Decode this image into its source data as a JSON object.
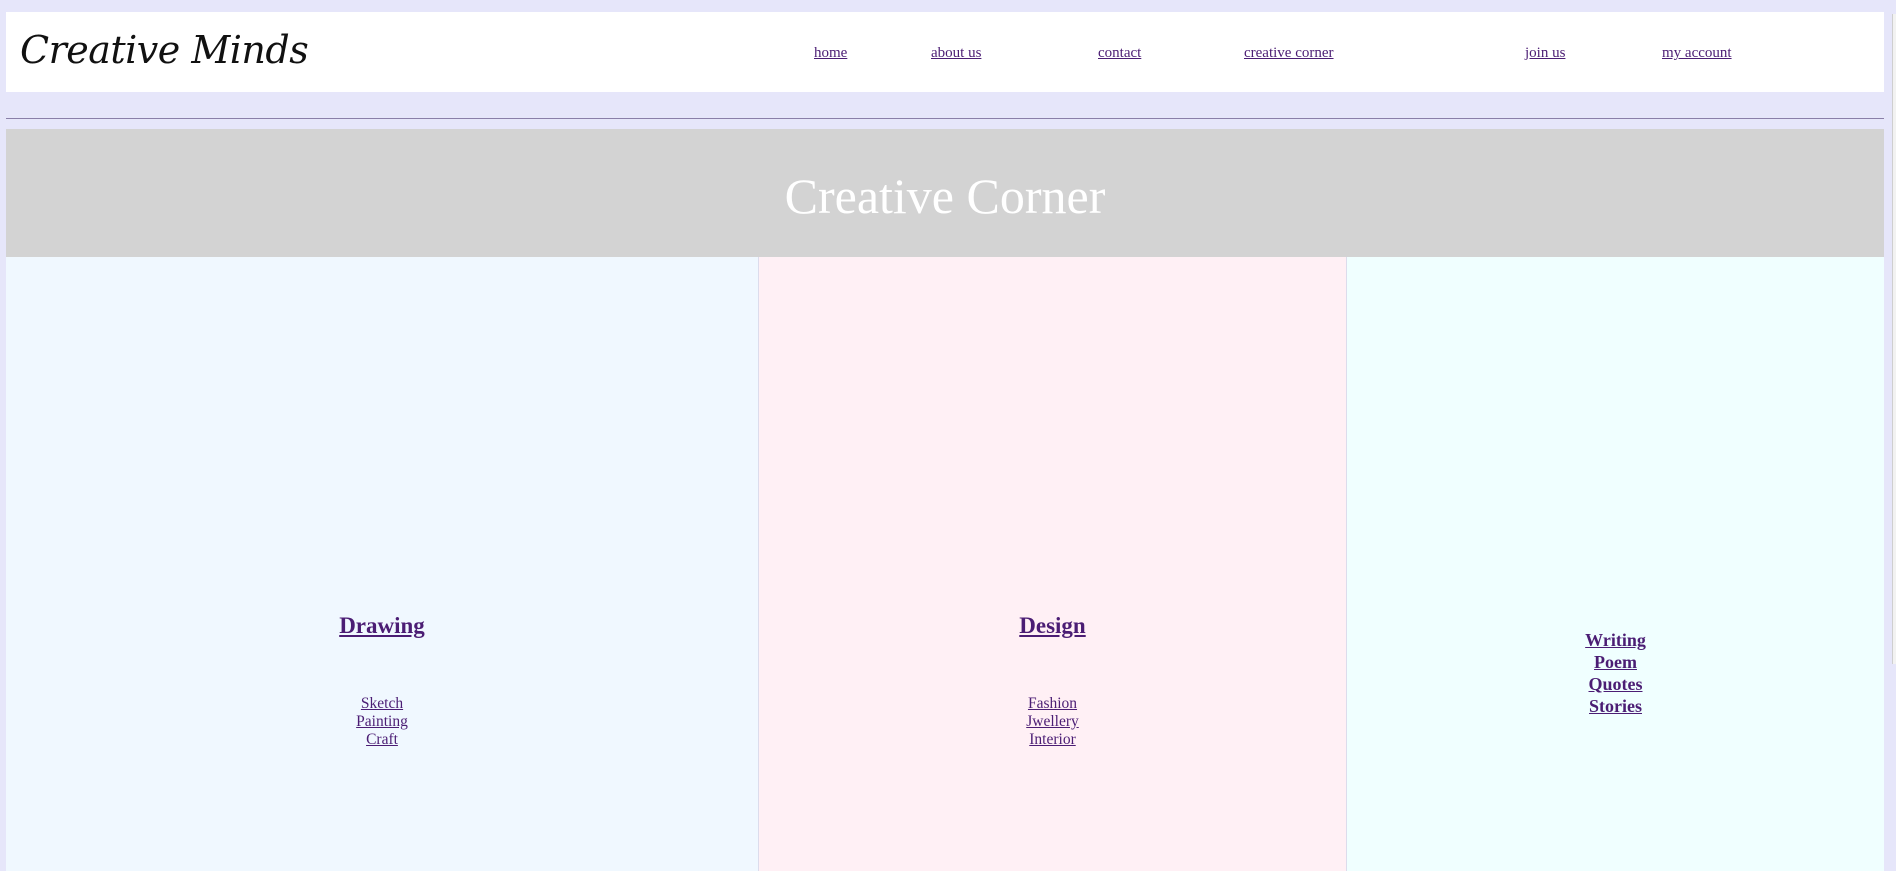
{
  "header": {
    "logo": "Creative Minds",
    "nav": [
      {
        "label": "home"
      },
      {
        "label": "about us"
      },
      {
        "label": "contact"
      },
      {
        "label": "creative corner"
      },
      {
        "label": "join us"
      },
      {
        "label": "my account"
      }
    ]
  },
  "banner": {
    "title": "Creative Corner"
  },
  "columns": {
    "drawing": {
      "heading": "Drawing",
      "links": [
        "Sketch",
        "Painting",
        "Craft"
      ]
    },
    "design": {
      "heading": "Design",
      "links": [
        "Fashion",
        "Jwellery",
        "Interior"
      ]
    },
    "writing": {
      "links": [
        "Writing",
        "Poem",
        "Quotes",
        "Stories"
      ]
    }
  },
  "colors": {
    "page_background": "#e6e6fa",
    "banner_background": "#d3d3d3",
    "drawing_background": "#f0f8ff",
    "design_background": "#fff0f5",
    "writing_background": "#f0ffff",
    "link": "#4b1d74"
  }
}
